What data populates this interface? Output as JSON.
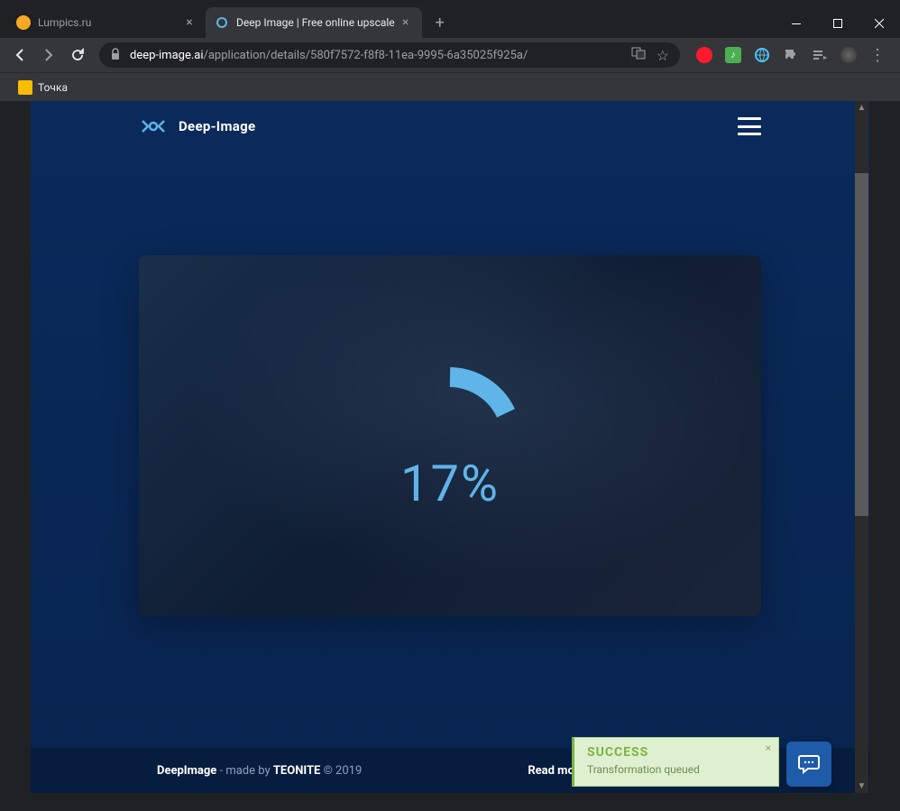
{
  "tabs": [
    {
      "title": "Lumpics.ru",
      "icon_color": "#f9a825"
    },
    {
      "title": "Deep Image | Free online upscale",
      "icon_color": "#5fb4e8"
    }
  ],
  "url": {
    "domain": "deep-image.ai",
    "path": "/application/details/580f7572-f8f8-11ea-9995-6a35025f925a/"
  },
  "bookmark": {
    "label": "Точка"
  },
  "brand": "Deep-Image",
  "progress": {
    "percent": "17%",
    "value": 17
  },
  "footer": {
    "left_brand": "DeepImage",
    "left_mid": " - made by ",
    "left_team": "TEONITE",
    "left_year": " © 2019",
    "right": "Read more about AI & Machine Learning:"
  },
  "toast": {
    "title": "SUCCESS",
    "message": "Transformation queued"
  }
}
